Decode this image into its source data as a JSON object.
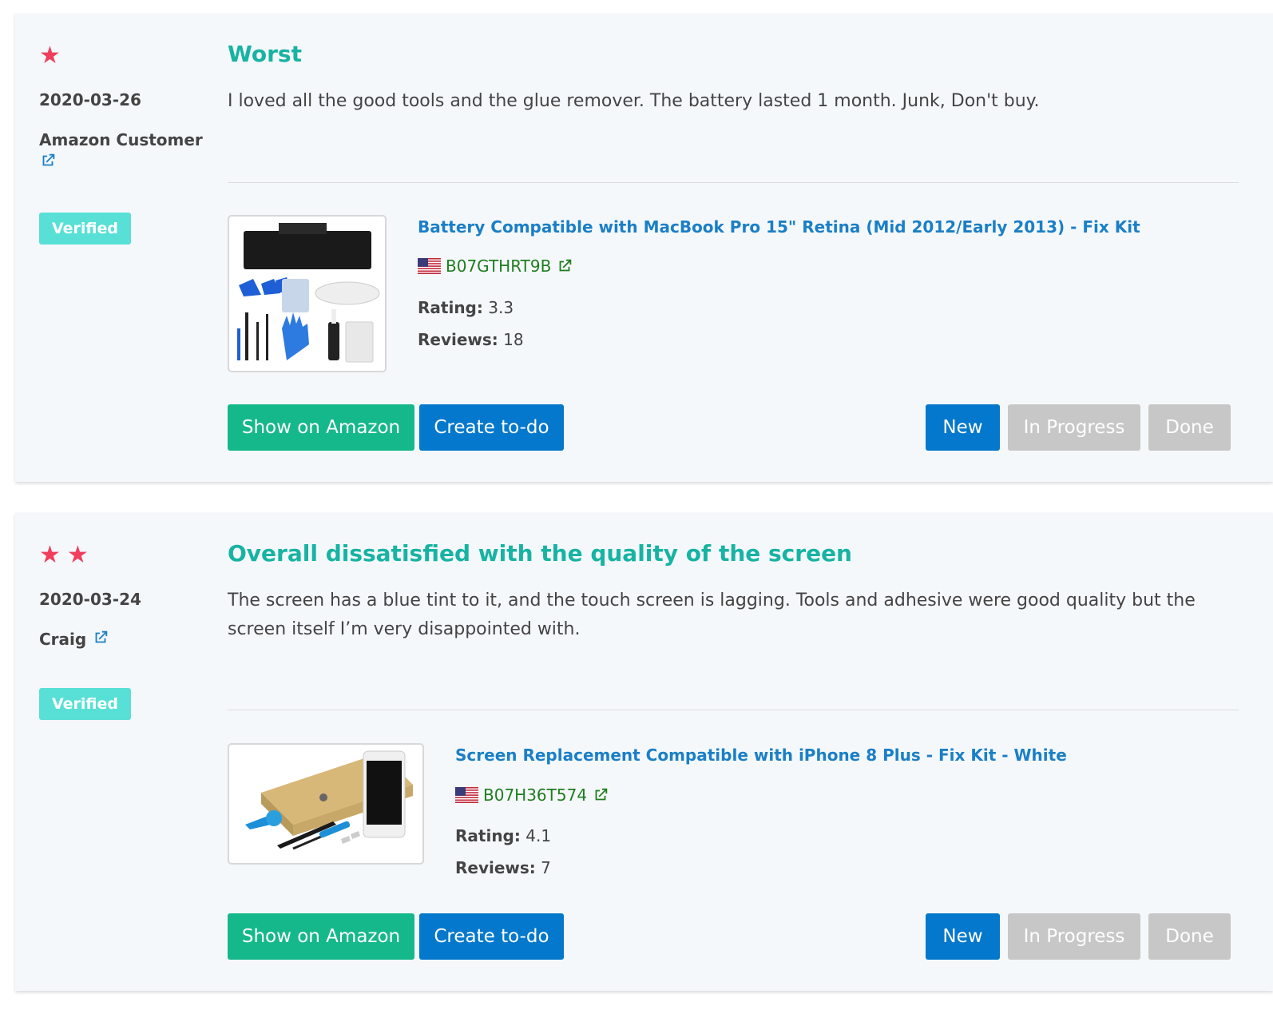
{
  "reviews": [
    {
      "stars": 1,
      "date": "2020-03-26",
      "author": "Amazon Customer",
      "badge": "Verified",
      "title": "Worst",
      "text": "I loved all the good tools and the glue remover. The battery lasted 1 month. Junk, Don't buy.",
      "product": {
        "title": "Battery Compatible with MacBook Pro 15\" Retina (Mid 2012/Early 2013) - Fix Kit",
        "asin": "B07GTHRT9B",
        "rating_label": "Rating:",
        "rating": "3.3",
        "reviews_label": "Reviews:",
        "reviews": "18"
      },
      "buttons": {
        "show": "Show on Amazon",
        "todo": "Create to-do",
        "new": "New",
        "in_progress": "In Progress",
        "done": "Done"
      }
    },
    {
      "stars": 2,
      "date": "2020-03-24",
      "author": "Craig",
      "badge": "Verified",
      "title": "Overall dissatisfied with the quality of the screen",
      "text": "The screen has a blue tint to it, and the touch screen is lagging. Tools and adhesive were good quality but the screen itself I’m very disappointed with.",
      "product": {
        "title": "Screen Replacement Compatible with iPhone 8 Plus - Fix Kit - White",
        "asin": "B07H36T574",
        "rating_label": "Rating:",
        "rating": "4.1",
        "reviews_label": "Reviews:",
        "reviews": "7"
      },
      "buttons": {
        "show": "Show on Amazon",
        "todo": "Create to-do",
        "new": "New",
        "in_progress": "In Progress",
        "done": "Done"
      }
    }
  ],
  "colors": {
    "star": "#f03e5d",
    "title": "#17b3a3",
    "link": "#1a7fc7",
    "asin": "#1f7d1f",
    "badge": "#58e0d6",
    "btn_green": "#15b88b",
    "btn_blue": "#0478cc",
    "btn_grey": "#c7c7c7"
  },
  "icons": [
    "star-icon",
    "external-link-icon",
    "us-flag-icon"
  ]
}
